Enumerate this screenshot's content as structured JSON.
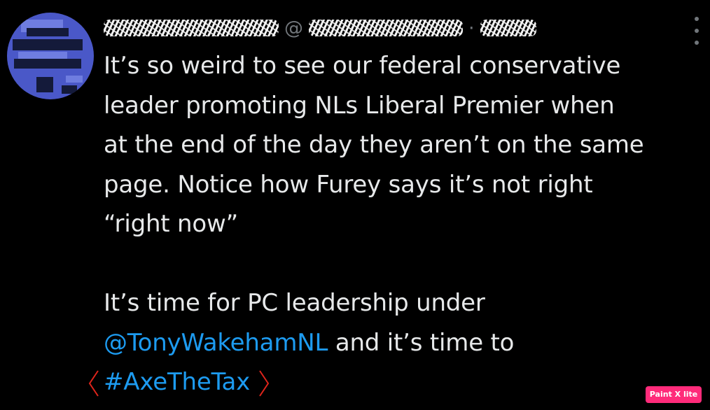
{
  "header": {
    "display_name": "",
    "handle_prefix": "@",
    "handle": "",
    "separator": "·",
    "timestamp": ""
  },
  "more_menu_icon": "more-dots-icon",
  "tweet": {
    "lines": [
      "It’s so weird to see our federal conservative",
      "leader promoting NLs Liberal Premier when",
      "at the end of the day they aren’t on the same",
      "page. Notice how Furey says it’s not right",
      "“right now”"
    ],
    "line6_start": "It’s time for PC leadership under",
    "mention": "@TonyWakehamNL",
    "line7_rest": " and it’s time to",
    "hashtag": "#AxeTheTax"
  },
  "colors": {
    "background": "#000000",
    "text": "#e7e9ea",
    "muted": "#71767b",
    "link": "#1d9bf0",
    "annotation": "#e0251b",
    "watermark_bg": "#ff2b7a"
  },
  "watermark": {
    "label": "Paint X lite"
  }
}
